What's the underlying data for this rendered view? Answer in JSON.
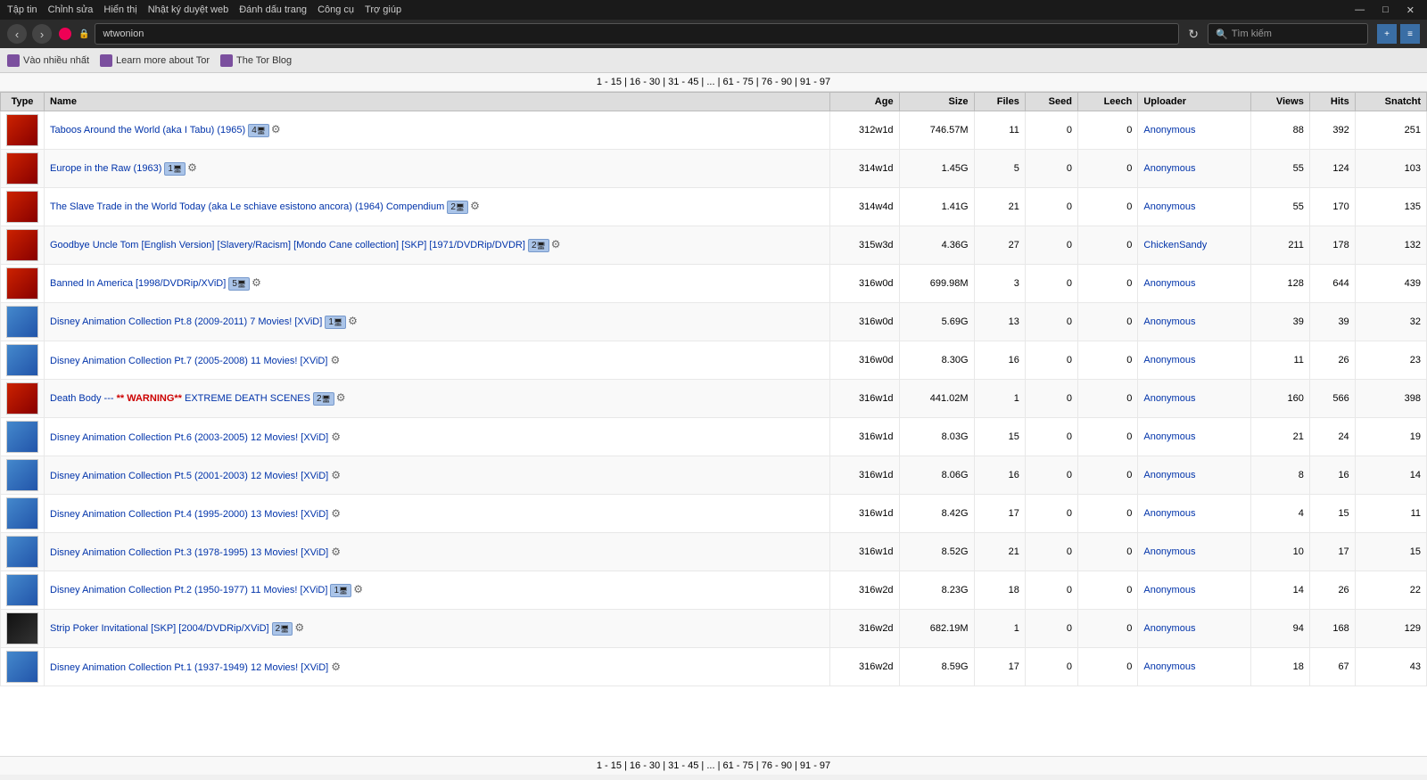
{
  "titlebar": {
    "menu_items": [
      "Tập tin",
      "Chỉnh sửa",
      "Hiển thị",
      "Nhật ký duyệt web",
      "Đánh dấu trang",
      "Công cụ",
      "Trợ giúp"
    ],
    "controls": [
      "—",
      "□",
      "✕"
    ]
  },
  "browser": {
    "url": "wtwonion",
    "search_placeholder": "Tìm kiếm",
    "reload": "↻"
  },
  "toolbar": {
    "items": [
      "Vào nhiều nhất",
      "Learn more about Tor",
      "The Tor Blog"
    ]
  },
  "pagination_top": "1 - 15 | 16 - 30 | 31 - 45 | ... | 61 - 75 | 76 - 90 | 91 - 97",
  "pagination_bottom": "1 - 15 | 16 - 30 | 31 - 45 | ... | 61 - 75 | 76 - 90 | 91 - 97",
  "table": {
    "headers": [
      "Type",
      "Name",
      "Age",
      "Size",
      "Files",
      "Seed",
      "Leech",
      "Uploader",
      "Views",
      "Hits",
      "Snatcht"
    ],
    "rows": [
      {
        "type": "red",
        "name": "Taboos Around the World (aka I Tabu) (1965)",
        "buttons": [
          "4",
          "↓"
        ],
        "age": "312w1d",
        "size": "746.57M",
        "files": 11,
        "seed": 0,
        "leech": 0,
        "uploader": "Anonymous",
        "views": 88,
        "hits": 392,
        "snatcht": 251
      },
      {
        "type": "red",
        "name": "Europe in the Raw (1963)",
        "buttons": [
          "1",
          "↓"
        ],
        "age": "314w1d",
        "size": "1.45G",
        "files": 5,
        "seed": 0,
        "leech": 0,
        "uploader": "Anonymous",
        "views": 55,
        "hits": 124,
        "snatcht": 103
      },
      {
        "type": "red",
        "name": "The Slave Trade in the World Today (aka Le schiave esistono ancora) (1964) Compendium",
        "buttons": [
          "2",
          "↓"
        ],
        "age": "314w4d",
        "size": "1.41G",
        "files": 21,
        "seed": 0,
        "leech": 0,
        "uploader": "Anonymous",
        "views": 55,
        "hits": 170,
        "snatcht": 135
      },
      {
        "type": "red",
        "name": "Goodbye Uncle Tom [English Version] [Slavery/Racism] [Mondo Cane collection] [SKP] [1971/DVDRip/DVDR]",
        "buttons": [
          "2",
          "↓"
        ],
        "age": "315w3d",
        "size": "4.36G",
        "files": 27,
        "seed": 0,
        "leech": 0,
        "uploader": "ChickenSandy",
        "views": 211,
        "hits": 178,
        "snatcht": 132
      },
      {
        "type": "red",
        "name": "Banned In America [1998/DVDRip/XViD]",
        "buttons": [
          "5",
          "↓"
        ],
        "age": "316w0d",
        "size": "699.98M",
        "files": 3,
        "seed": 0,
        "leech": 0,
        "uploader": "Anonymous",
        "views": 128,
        "hits": 644,
        "snatcht": 439
      },
      {
        "type": "disney",
        "name": "Disney Animation Collection Pt.8 (2009-2011) 7 Movies! [XViD]",
        "buttons": [
          "1",
          "↓"
        ],
        "age": "316w0d",
        "size": "5.69G",
        "files": 13,
        "seed": 0,
        "leech": 0,
        "uploader": "Anonymous",
        "views": 39,
        "hits": 39,
        "snatcht": 32
      },
      {
        "type": "disney",
        "name": "Disney Animation Collection Pt.7 (2005-2008) 11 Movies! [XViD]",
        "buttons": [
          "↓"
        ],
        "age": "316w0d",
        "size": "8.30G",
        "files": 16,
        "seed": 0,
        "leech": 0,
        "uploader": "Anonymous",
        "views": 11,
        "hits": 26,
        "snatcht": 23
      },
      {
        "type": "red",
        "name": "Death Body --- ** WARNING** EXTREME DEATH SCENES",
        "buttons": [
          "2",
          "↓"
        ],
        "age": "316w1d",
        "size": "441.02M",
        "files": 1,
        "seed": 0,
        "leech": 0,
        "uploader": "Anonymous",
        "views": 160,
        "hits": 566,
        "snatcht": 398
      },
      {
        "type": "disney",
        "name": "Disney Animation Collection Pt.6 (2003-2005) 12 Movies! [XViD]",
        "buttons": [
          "↓"
        ],
        "age": "316w1d",
        "size": "8.03G",
        "files": 15,
        "seed": 0,
        "leech": 0,
        "uploader": "Anonymous",
        "views": 21,
        "hits": 24,
        "snatcht": 19
      },
      {
        "type": "disney",
        "name": "Disney Animation Collection Pt.5 (2001-2003) 12 Movies! [XViD]",
        "buttons": [
          "↓"
        ],
        "age": "316w1d",
        "size": "8.06G",
        "files": 16,
        "seed": 0,
        "leech": 0,
        "uploader": "Anonymous",
        "views": 8,
        "hits": 16,
        "snatcht": 14
      },
      {
        "type": "disney",
        "name": "Disney Animation Collection Pt.4 (1995-2000) 13 Movies! [XViD]",
        "buttons": [
          "↓"
        ],
        "age": "316w1d",
        "size": "8.42G",
        "files": 17,
        "seed": 0,
        "leech": 0,
        "uploader": "Anonymous",
        "views": 4,
        "hits": 15,
        "snatcht": 11
      },
      {
        "type": "disney",
        "name": "Disney Animation Collection Pt.3 (1978-1995) 13 Movies! [XViD]",
        "buttons": [
          "↓"
        ],
        "age": "316w1d",
        "size": "8.52G",
        "files": 21,
        "seed": 0,
        "leech": 0,
        "uploader": "Anonymous",
        "views": 10,
        "hits": 17,
        "snatcht": 15
      },
      {
        "type": "disney",
        "name": "Disney Animation Collection Pt.2 (1950-1977) 11 Movies! [XViD]",
        "buttons": [
          "1",
          "↓"
        ],
        "age": "316w2d",
        "size": "8.23G",
        "files": 18,
        "seed": 0,
        "leech": 0,
        "uploader": "Anonymous",
        "views": 14,
        "hits": 26,
        "snatcht": 22
      },
      {
        "type": "strip",
        "name": "Strip Poker Invitational [SKP] [2004/DVDRip/XViD]",
        "buttons": [
          "2",
          "↓"
        ],
        "age": "316w2d",
        "size": "682.19M",
        "files": 1,
        "seed": 0,
        "leech": 0,
        "uploader": "Anonymous",
        "views": 94,
        "hits": 168,
        "snatcht": 129
      },
      {
        "type": "disney",
        "name": "Disney Animation Collection Pt.1 (1937-1949) 12 Movies! [XViD]",
        "buttons": [
          "↓"
        ],
        "age": "316w2d",
        "size": "8.59G",
        "files": 17,
        "seed": 0,
        "leech": 0,
        "uploader": "Anonymous",
        "views": 18,
        "hits": 67,
        "snatcht": 43
      }
    ]
  }
}
